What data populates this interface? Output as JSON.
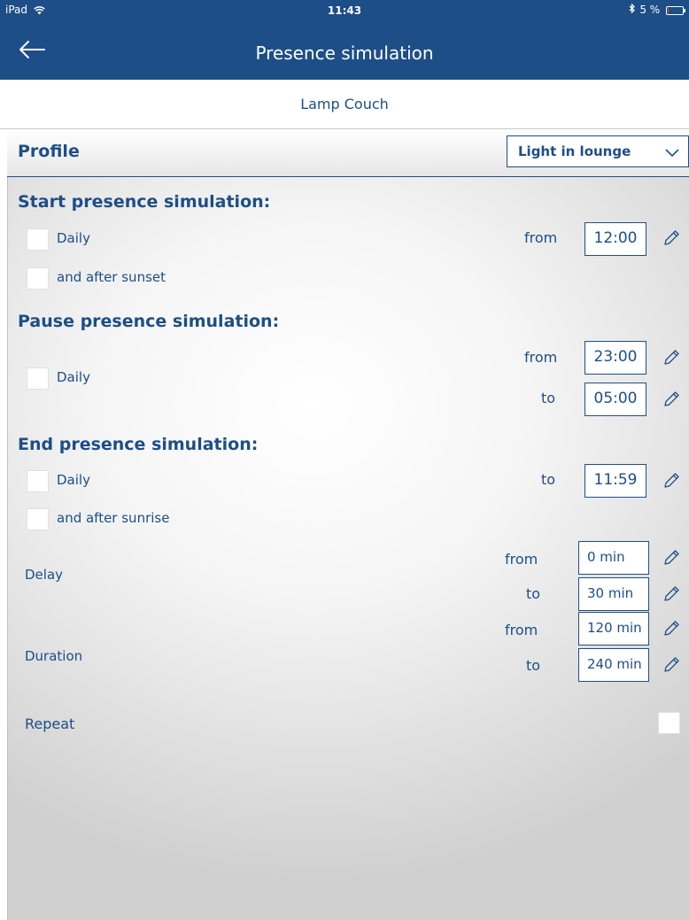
{
  "status": {
    "carrier": "iPad",
    "time": "11:43",
    "battery": "5 %"
  },
  "nav": {
    "title": "Presence simulation"
  },
  "device": {
    "name": "Lamp Couch"
  },
  "profile": {
    "label": "Profile",
    "selected": "Light in lounge"
  },
  "start": {
    "heading": "Start presence simulation:",
    "daily_label": "Daily",
    "sunset_label": "and after sunset",
    "from_label": "from",
    "from_time": "12:00"
  },
  "pause": {
    "heading": "Pause presence simulation:",
    "daily_label": "Daily",
    "from_label": "from",
    "from_time": "23:00",
    "to_label": "to",
    "to_time": "05:00"
  },
  "end": {
    "heading": "End presence simulation:",
    "daily_label": "Daily",
    "sunrise_label": "and after sunrise",
    "to_label": "to",
    "to_time": "11:59"
  },
  "delay": {
    "label": "Delay",
    "from_label": "from",
    "from_value": "0 min",
    "to_label": "to",
    "to_value": "30 min"
  },
  "duration": {
    "label": "Duration",
    "from_label": "from",
    "from_value": "120 min",
    "to_label": "to",
    "to_value": "240 min"
  },
  "repeat": {
    "label": "Repeat"
  },
  "colors": {
    "brand": "#1d4e87",
    "background": "#ffffff",
    "panel_edge": "#d0d0d0"
  },
  "icons": [
    "wifi-icon",
    "bluetooth-icon",
    "battery-icon",
    "back-arrow-icon",
    "chevron-down-icon",
    "pencil-icon"
  ]
}
